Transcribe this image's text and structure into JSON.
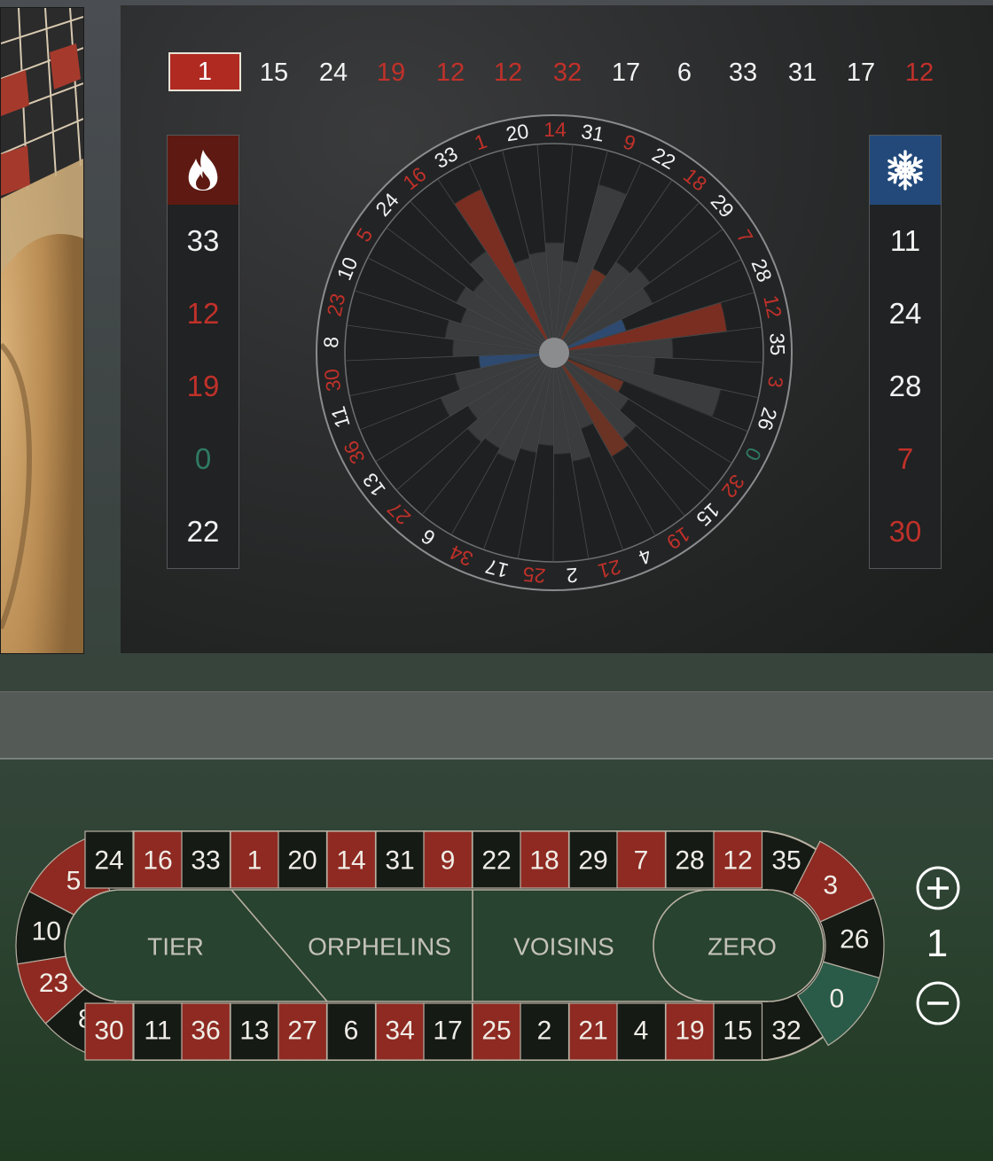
{
  "recent_results": [
    {
      "n": "1",
      "c": "red"
    },
    {
      "n": "15",
      "c": "black"
    },
    {
      "n": "24",
      "c": "black"
    },
    {
      "n": "19",
      "c": "red"
    },
    {
      "n": "12",
      "c": "red"
    },
    {
      "n": "12",
      "c": "red"
    },
    {
      "n": "32",
      "c": "red"
    },
    {
      "n": "17",
      "c": "black"
    },
    {
      "n": "6",
      "c": "black"
    },
    {
      "n": "33",
      "c": "black"
    },
    {
      "n": "31",
      "c": "black"
    },
    {
      "n": "17",
      "c": "black"
    },
    {
      "n": "12",
      "c": "red"
    }
  ],
  "hot_numbers": {
    "icon": "fire-icon",
    "accent": "#6b1a12",
    "items": [
      {
        "n": "33",
        "c": "black"
      },
      {
        "n": "12",
        "c": "red"
      },
      {
        "n": "19",
        "c": "red"
      },
      {
        "n": "0",
        "c": "green"
      },
      {
        "n": "22",
        "c": "black"
      }
    ]
  },
  "cold_numbers": {
    "icon": "snowflake-icon",
    "accent": "#244a7a",
    "items": [
      {
        "n": "11",
        "c": "black"
      },
      {
        "n": "24",
        "c": "black"
      },
      {
        "n": "28",
        "c": "black"
      },
      {
        "n": "7",
        "c": "red"
      },
      {
        "n": "30",
        "c": "red"
      }
    ]
  },
  "wheel": {
    "order": [
      "0",
      "32",
      "15",
      "19",
      "4",
      "21",
      "2",
      "25",
      "17",
      "34",
      "6",
      "27",
      "13",
      "36",
      "11",
      "30",
      "8",
      "23",
      "10",
      "5",
      "24",
      "16",
      "33",
      "1",
      "20",
      "14",
      "31",
      "9",
      "22",
      "18",
      "29",
      "7",
      "28",
      "12",
      "35",
      "3",
      "26"
    ],
    "red_numbers": [
      "1",
      "3",
      "5",
      "7",
      "9",
      "12",
      "14",
      "16",
      "18",
      "19",
      "21",
      "23",
      "25",
      "27",
      "30",
      "32",
      "34",
      "36"
    ],
    "frequency": [
      0.35,
      0.42,
      0.55,
      0.6,
      0.38,
      0.55,
      0.5,
      0.45,
      0.5,
      0.58,
      0.55,
      0.58,
      0.5,
      0.62,
      0.5,
      0.35,
      0.5,
      0.55,
      0.48,
      0.55,
      0.5,
      0.62,
      0.95,
      0.48,
      0.5,
      0.55,
      0.45,
      0.92,
      0.45,
      0.55,
      0.6,
      0.55,
      0.35,
      0.92,
      0.6,
      0.5,
      0.9
    ]
  },
  "racetrack": {
    "top_row": [
      "24",
      "16",
      "33",
      "1",
      "20",
      "14",
      "31",
      "9",
      "22",
      "18",
      "29",
      "7",
      "28",
      "12",
      "35"
    ],
    "bottom_row": [
      "30",
      "11",
      "36",
      "13",
      "27",
      "6",
      "34",
      "17",
      "25",
      "2",
      "21",
      "4",
      "19",
      "15",
      "32"
    ],
    "left_end": [
      "5",
      "10",
      "23",
      "8"
    ],
    "right_end": [
      "3",
      "26",
      "0"
    ],
    "sections": [
      "TIER",
      "ORPHELINS",
      "VOISINS",
      "ZERO"
    ]
  },
  "neighbours": {
    "value": "1",
    "increase_icon": "plus-icon",
    "decrease_icon": "minus-icon"
  },
  "colors": {
    "red": "#8e2a22",
    "black": "#151a15",
    "green": "#2a5a48",
    "red_text": "#c0312a",
    "green_text": "#2f7a62"
  }
}
